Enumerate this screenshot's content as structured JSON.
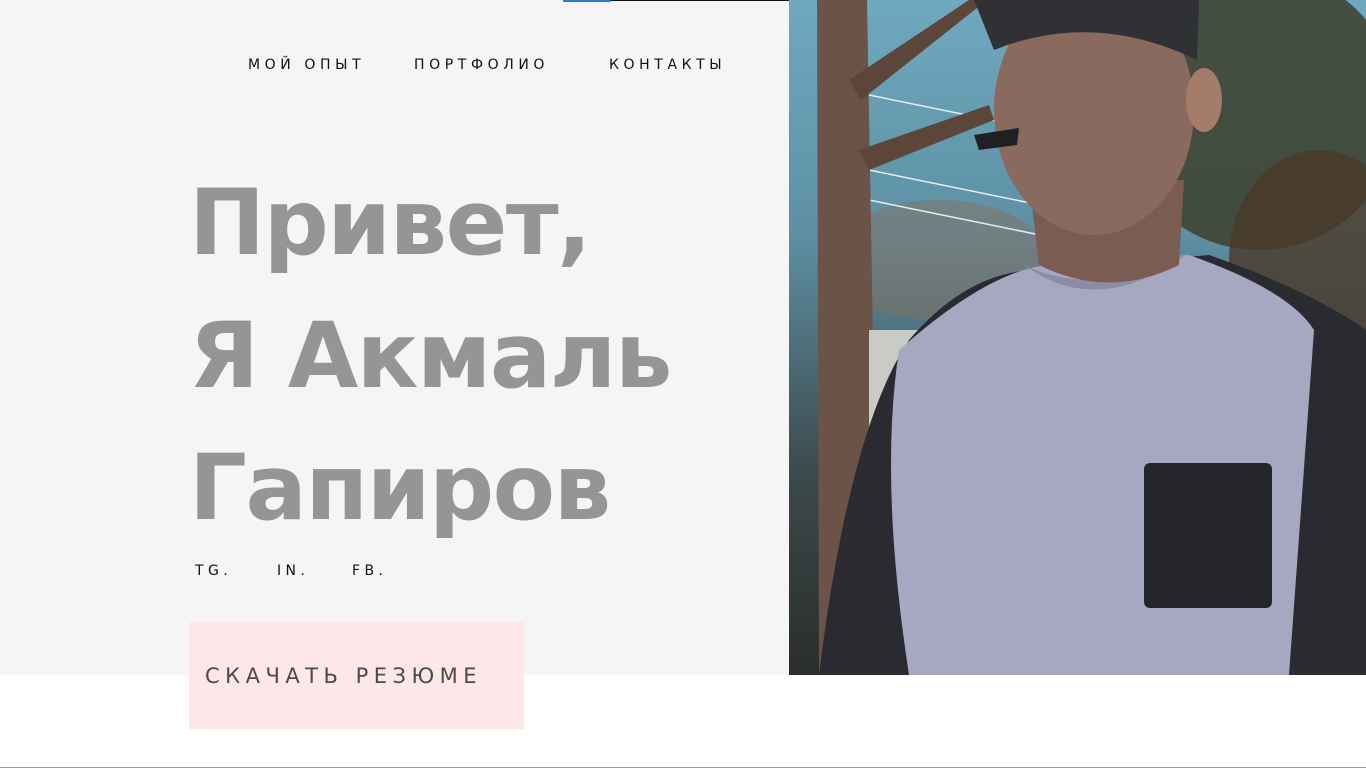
{
  "nav": {
    "items": [
      {
        "label": "МОЙ ОПЫТ"
      },
      {
        "label": "ПОРТФОЛИО"
      },
      {
        "label": "КОНТАКТЫ"
      }
    ]
  },
  "hero": {
    "headline_lines": [
      "Привет,",
      "Я Акмаль",
      "Гапиров"
    ],
    "social_links": [
      "TG.",
      "IN.",
      "FB."
    ],
    "download_button_label": "СКАЧАТЬ РЕЗЮМЕ"
  },
  "colors": {
    "panel_background": "#f5f5f5",
    "headline": "#959595",
    "cta_background": "#fde7e8",
    "accent_line": "#2a7fd4"
  },
  "icons": {
    "profile_photo": "portrait-photo"
  }
}
